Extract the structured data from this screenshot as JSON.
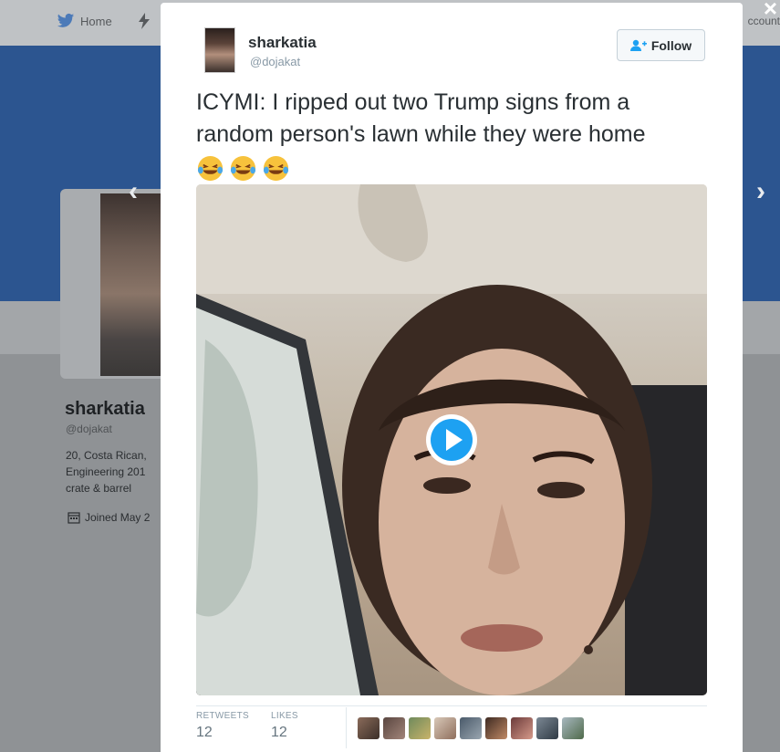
{
  "background_page": {
    "nav": [
      {
        "label": "Home",
        "icon": "twitter-bird-icon"
      },
      {
        "label": "",
        "icon": "lightning-icon"
      }
    ],
    "account_label": "ccount",
    "profile": {
      "name": "sharkatia",
      "handle": "@dojakat",
      "bio_lines": [
        "20, Costa Rican,",
        "Engineering 201",
        "crate & barrel"
      ],
      "joined": "Joined May 2"
    },
    "prev_icon": "chevron-left-icon",
    "next_icon": "chevron-right-icon"
  },
  "modal": {
    "close_icon": "close-icon",
    "user": {
      "name": "sharkatia",
      "handle": "@dojakat"
    },
    "follow_label": "Follow",
    "tweet_text": "ICYMI: I ripped out two Trump signs from a random person's lawn while they were home",
    "emojis": [
      "laughing-tears-emoji",
      "laughing-tears-emoji",
      "laughing-tears-emoji"
    ],
    "media": {
      "type": "video",
      "play_icon": "play-icon"
    },
    "stats": [
      {
        "label": "RETWEETS",
        "value": "12"
      },
      {
        "label": "LIKES",
        "value": "12"
      }
    ],
    "likers_count_shown": 9
  },
  "colors": {
    "banner": "#2c5590",
    "twitter_blue": "#1da1f2",
    "text_primary": "#292f33",
    "text_secondary": "#8899a6"
  }
}
